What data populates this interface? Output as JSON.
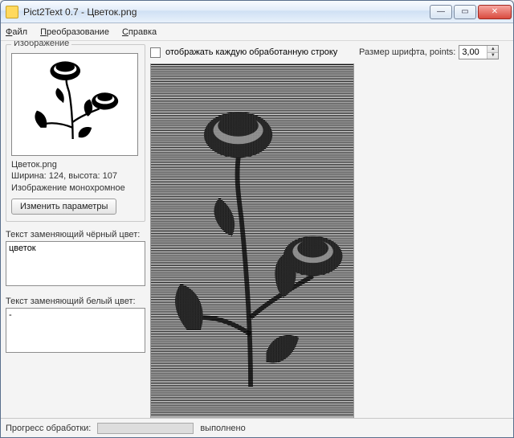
{
  "window": {
    "title": "Pict2Text 0.7 - Цветок.png"
  },
  "menu": {
    "file": "Файл",
    "transform": "Преобразование",
    "help": "Справка"
  },
  "left": {
    "group_label": "Изображение",
    "file_name": "Цветок.png",
    "dimensions": "Ширина: 124, высота: 107",
    "mode": "Изображение монохромное",
    "change_params_btn": "Изменить параметры",
    "black_text_label": "Текст заменяющий чёрный цвет:",
    "black_text_value": "цветок",
    "white_text_label": "Текст заменяющий белый цвет:",
    "white_text_value": "-"
  },
  "center": {
    "checkbox_label": "отображать каждую обработанную строку"
  },
  "right": {
    "font_label": "Размер шрифта, points:",
    "font_value": "3,00"
  },
  "status": {
    "progress_label": "Прогресс обработки:",
    "done_label": "выполнено"
  },
  "icons": {
    "minimize": "—",
    "maximize": "▭",
    "close": "✕",
    "spin_up": "▲",
    "spin_down": "▼"
  }
}
